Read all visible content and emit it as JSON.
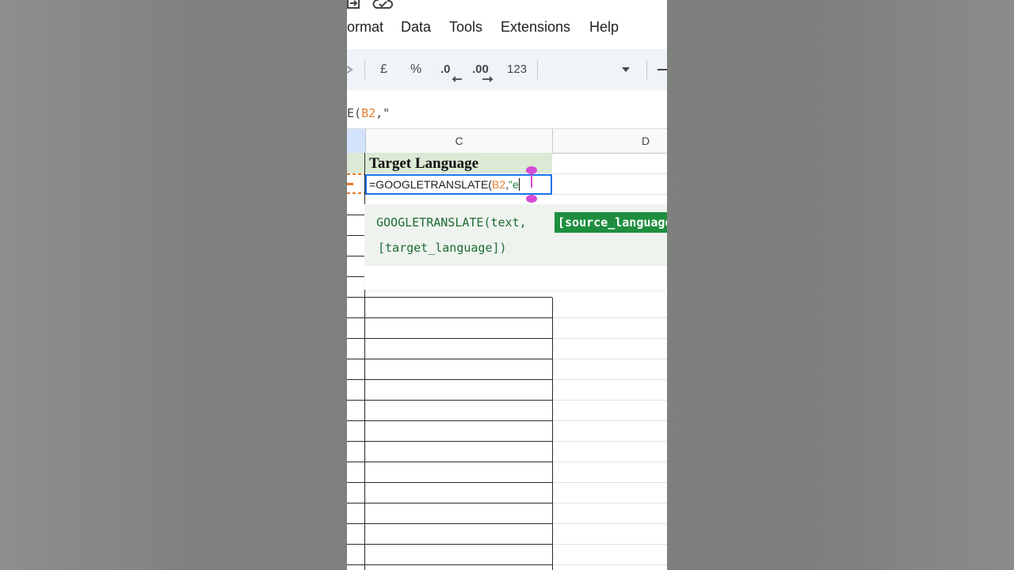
{
  "menu": {
    "items": [
      {
        "label": "ormat"
      },
      {
        "label": "Data"
      },
      {
        "label": "Tools"
      },
      {
        "label": "Extensions"
      },
      {
        "label": "Help"
      }
    ]
  },
  "toolbar": {
    "currency": "£",
    "percent": "%",
    "decrease_decimal": ".0",
    "increase_decimal": ".00",
    "number_format": "123"
  },
  "formula_bar": {
    "prefix": "E(",
    "ref": "B2",
    "suffix": ",\""
  },
  "columns": {
    "c": "C",
    "d": "D"
  },
  "sheet": {
    "header_cell": "Target Language",
    "active_cell": {
      "prefix": "=GOOGLETRANSLATE(",
      "ref": "B2",
      "comma": ",",
      "string": "\"e"
    }
  },
  "autocomplete": {
    "fn_part": "GOOGLETRANSLATE(text,",
    "active_arg": "[source_language]",
    "next_line": "[target_language])"
  },
  "colors": {
    "accent_blue": "#1a73e8",
    "header_fill": "#dbe9d5",
    "active_arg_bg": "#1e8e3e",
    "selection_handle": "#d54ad5"
  }
}
